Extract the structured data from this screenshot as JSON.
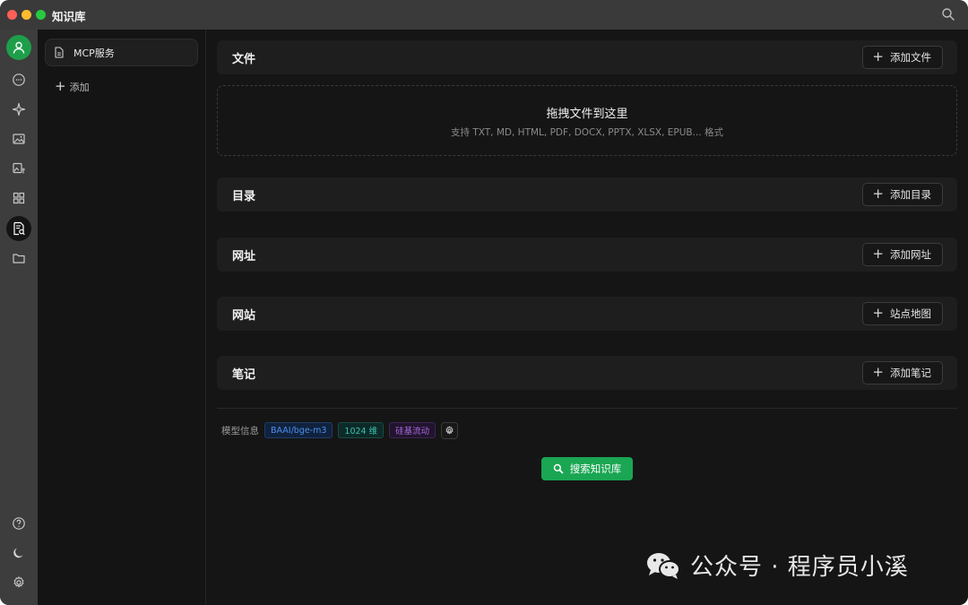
{
  "window": {
    "title": "知识库"
  },
  "kb_list": {
    "items": [
      {
        "label": "MCP服务"
      }
    ],
    "add_label": "添加"
  },
  "sections": {
    "file": {
      "title": "文件",
      "button": "添加文件"
    },
    "directory": {
      "title": "目录",
      "button": "添加目录"
    },
    "url": {
      "title": "网址",
      "button": "添加网址"
    },
    "website": {
      "title": "网站",
      "button": "站点地图"
    },
    "note": {
      "title": "笔记",
      "button": "添加笔记"
    }
  },
  "dropzone": {
    "main": "拖拽文件到这里",
    "sub": "支持 TXT, MD, HTML, PDF, DOCX, PPTX, XLSX, EPUB... 格式"
  },
  "model_info": {
    "label": "模型信息",
    "model": "BAAI/bge-m3",
    "dimension": "1024 维",
    "provider": "硅基流动"
  },
  "search_button": "搜索知识库",
  "watermark": "公众号 · 程序员小溪",
  "colors": {
    "accent": "#1aa653",
    "avatar": "#1e9e4a",
    "tag_blue": "#4d8ef0",
    "tag_teal": "#3cc1b0",
    "tag_purple": "#a66ad9"
  }
}
